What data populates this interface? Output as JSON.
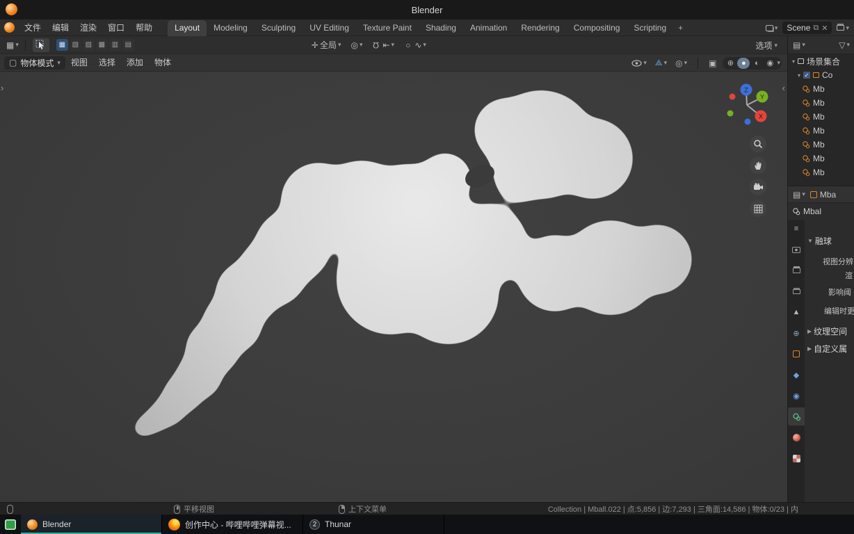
{
  "titlebar": {
    "title": "Blender"
  },
  "menubar": {
    "menus": [
      "文件",
      "编辑",
      "渲染",
      "窗口",
      "帮助"
    ],
    "workspaces": [
      "Layout",
      "Modeling",
      "Sculpting",
      "UV Editing",
      "Texture Paint",
      "Shading",
      "Animation",
      "Rendering",
      "Compositing",
      "Scripting"
    ],
    "active_workspace": "Layout",
    "new_workspace_label": "+",
    "scene_name": "Scene"
  },
  "tool_settings": {
    "transform_orientation": "全局",
    "options_label": "选项"
  },
  "viewport": {
    "mode": "物体模式",
    "menus": [
      "视图",
      "选择",
      "添加",
      "物体"
    ],
    "axis_labels": {
      "x": "X",
      "y": "Y",
      "z": "Z"
    }
  },
  "outliner": {
    "scene_collection": "场景集合",
    "collection_label": "Co",
    "items": [
      "Mb",
      "Mb",
      "Mb",
      "Mb",
      "Mb",
      "Mb",
      "Mb"
    ]
  },
  "properties": {
    "breadcrumb_object": "Mba",
    "breadcrumb_data": "Mbal",
    "metaball_panel": "融球",
    "fields": [
      "视图分辨",
      "渲",
      "影响阈",
      "编辑时更"
    ],
    "texture_space_panel": "纹理空间",
    "custom_props_panel": "自定义属"
  },
  "statusbar": {
    "hint_pan": "平移视图",
    "hint_context_menu": "上下文菜单",
    "stats": "Collection | Mball.022 | 点:5,856 | 边:7,293 | 三角面:14,586 | 物体:0/23 | 内"
  },
  "taskbar": {
    "blender": "Blender",
    "firefox": "创作中心 - 哔哩哔哩弹幕视...",
    "thunar": "Thunar",
    "thunar_badge": "2"
  },
  "colors": {
    "accent": "#4772b3",
    "taskbar_accent": "#2fb3a3",
    "axis_x": "#e2453c",
    "axis_y": "#77b021",
    "axis_z": "#3d6fd8",
    "object_orange": "#e0862d"
  }
}
